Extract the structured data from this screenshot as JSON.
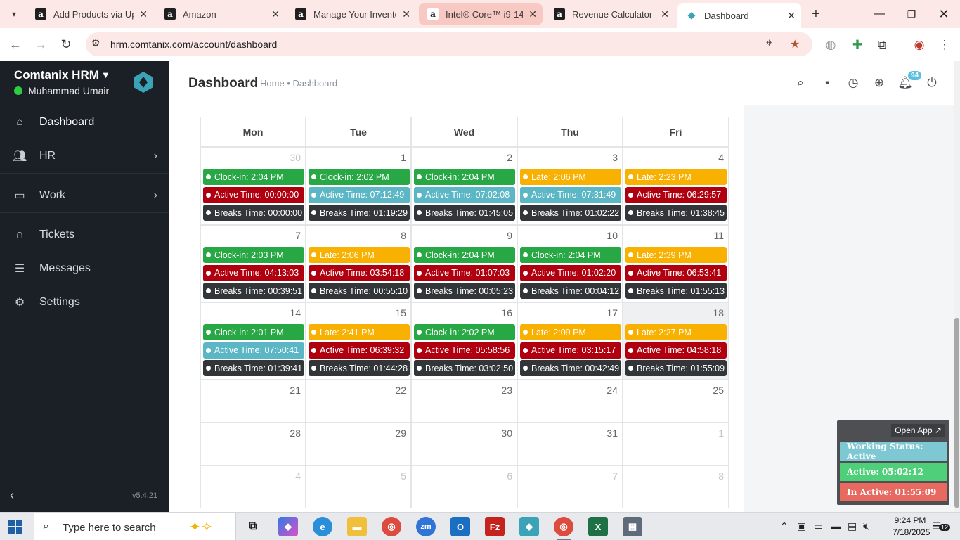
{
  "browser": {
    "tabs": [
      {
        "title": "Add Products via Upl",
        "fav": "a"
      },
      {
        "title": "Amazon",
        "fav": "a"
      },
      {
        "title": "Manage Your Invento",
        "fav": "a"
      },
      {
        "title": "Intel® Core™ i9-1490",
        "fav": "a"
      },
      {
        "title": "Revenue Calculator",
        "fav": "a"
      },
      {
        "title": "Dashboard",
        "fav": "◆"
      }
    ],
    "url": "hrm.comtanix.com/account/dashboard"
  },
  "sidebar": {
    "brand": "Comtanix HRM",
    "user": "Muhammad Umair",
    "items": [
      {
        "label": "Dashboard",
        "icon": "home-icon"
      },
      {
        "label": "HR",
        "icon": "users-icon"
      },
      {
        "label": "Work",
        "icon": "briefcase-icon"
      },
      {
        "label": "Tickets",
        "icon": "headset-icon"
      },
      {
        "label": "Messages",
        "icon": "message-icon"
      },
      {
        "label": "Settings",
        "icon": "gear-icon"
      }
    ],
    "version": "v5.4.21"
  },
  "header": {
    "title": "Dashboard",
    "breadcrumb": "Home • Dashboard",
    "badge": "94"
  },
  "calendar": {
    "days": [
      "Mon",
      "Tue",
      "Wed",
      "Thu",
      "Fri"
    ],
    "weeks": [
      [
        {
          "d": "30",
          "muted": true,
          "ev": [
            [
              "green",
              "Clock-in: 2:04 PM"
            ],
            [
              "red",
              "Active Time: 00:00:00"
            ],
            [
              "dark",
              "Breaks Time: 00:00:00"
            ]
          ]
        },
        {
          "d": "1",
          "ev": [
            [
              "green",
              "Clock-in: 2:02 PM"
            ],
            [
              "teal",
              "Active Time: 07:12:49"
            ],
            [
              "dark",
              "Breaks Time: 01:19:29"
            ]
          ]
        },
        {
          "d": "2",
          "ev": [
            [
              "green",
              "Clock-in: 2:04 PM"
            ],
            [
              "teal",
              "Active Time: 07:02:08"
            ],
            [
              "dark",
              "Breaks Time: 01:45:05"
            ]
          ]
        },
        {
          "d": "3",
          "ev": [
            [
              "amber",
              "Late: 2:06 PM"
            ],
            [
              "teal",
              "Active Time: 07:31:49"
            ],
            [
              "dark",
              "Breaks Time: 01:02:22"
            ]
          ]
        },
        {
          "d": "4",
          "ev": [
            [
              "amber",
              "Late: 2:23 PM"
            ],
            [
              "red",
              "Active Time: 06:29:57"
            ],
            [
              "dark",
              "Breaks Time: 01:38:45"
            ]
          ]
        }
      ],
      [
        {
          "d": "7",
          "ev": [
            [
              "green",
              "Clock-in: 2:03 PM"
            ],
            [
              "red",
              "Active Time: 04:13:03"
            ],
            [
              "dark",
              "Breaks Time: 00:39:51"
            ]
          ]
        },
        {
          "d": "8",
          "ev": [
            [
              "amber",
              "Late: 2:06 PM"
            ],
            [
              "red",
              "Active Time: 03:54:18"
            ],
            [
              "dark",
              "Breaks Time: 00:55:10"
            ]
          ]
        },
        {
          "d": "9",
          "ev": [
            [
              "green",
              "Clock-in: 2:04 PM"
            ],
            [
              "red",
              "Active Time: 01:07:03"
            ],
            [
              "dark",
              "Breaks Time: 00:05:23"
            ]
          ]
        },
        {
          "d": "10",
          "ev": [
            [
              "green",
              "Clock-in: 2:04 PM"
            ],
            [
              "red",
              "Active Time: 01:02:20"
            ],
            [
              "dark",
              "Breaks Time: 00:04:12"
            ]
          ]
        },
        {
          "d": "11",
          "ev": [
            [
              "amber",
              "Late: 2:39 PM"
            ],
            [
              "red",
              "Active Time: 06:53:41"
            ],
            [
              "dark",
              "Breaks Time: 01:55:13"
            ]
          ]
        }
      ],
      [
        {
          "d": "14",
          "ev": [
            [
              "green",
              "Clock-in: 2:01 PM"
            ],
            [
              "teal",
              "Active Time: 07:50:41"
            ],
            [
              "dark",
              "Breaks Time: 01:39:41"
            ]
          ]
        },
        {
          "d": "15",
          "ev": [
            [
              "amber",
              "Late: 2:41 PM"
            ],
            [
              "red",
              "Active Time: 06:39:32"
            ],
            [
              "dark",
              "Breaks Time: 01:44:28"
            ]
          ]
        },
        {
          "d": "16",
          "ev": [
            [
              "green",
              "Clock-in: 2:02 PM"
            ],
            [
              "red",
              "Active Time: 05:58:56"
            ],
            [
              "dark",
              "Breaks Time: 03:02:50"
            ]
          ]
        },
        {
          "d": "17",
          "ev": [
            [
              "amber",
              "Late: 2:09 PM"
            ],
            [
              "red",
              "Active Time: 03:15:17"
            ],
            [
              "dark",
              "Breaks Time: 00:42:49"
            ]
          ]
        },
        {
          "d": "18",
          "today": true,
          "ev": [
            [
              "amber",
              "Late: 2:27 PM"
            ],
            [
              "red",
              "Active Time: 04:58:18"
            ],
            [
              "dark",
              "Breaks Time: 01:55:09"
            ]
          ]
        }
      ],
      [
        {
          "d": "21",
          "ev": []
        },
        {
          "d": "22",
          "ev": []
        },
        {
          "d": "23",
          "ev": []
        },
        {
          "d": "24",
          "ev": []
        },
        {
          "d": "25",
          "ev": []
        }
      ],
      [
        {
          "d": "28",
          "ev": []
        },
        {
          "d": "29",
          "ev": []
        },
        {
          "d": "30",
          "ev": []
        },
        {
          "d": "31",
          "ev": []
        },
        {
          "d": "1",
          "muted": true,
          "ev": []
        }
      ],
      [
        {
          "d": "4",
          "muted": true,
          "ev": []
        },
        {
          "d": "5",
          "muted": true,
          "ev": []
        },
        {
          "d": "6",
          "muted": true,
          "ev": []
        },
        {
          "d": "7",
          "muted": true,
          "ev": []
        },
        {
          "d": "8",
          "muted": true,
          "ev": []
        }
      ]
    ]
  },
  "widget": {
    "open_label": "Open App ↗",
    "status": "Working Status: Active",
    "active": "Active: 05:02:12",
    "inactive": "In Active: 01:55:09"
  },
  "taskbar": {
    "search_placeholder": "Type here to search",
    "time": "9:24 PM",
    "date": "7/18/2025",
    "notifications": "12"
  },
  "colors": {
    "green": "#28a745",
    "amber": "#f8b100",
    "red": "#b0000f",
    "teal": "#5bb6c6",
    "dark": "#333639",
    "sidebar": "#1b2026"
  }
}
